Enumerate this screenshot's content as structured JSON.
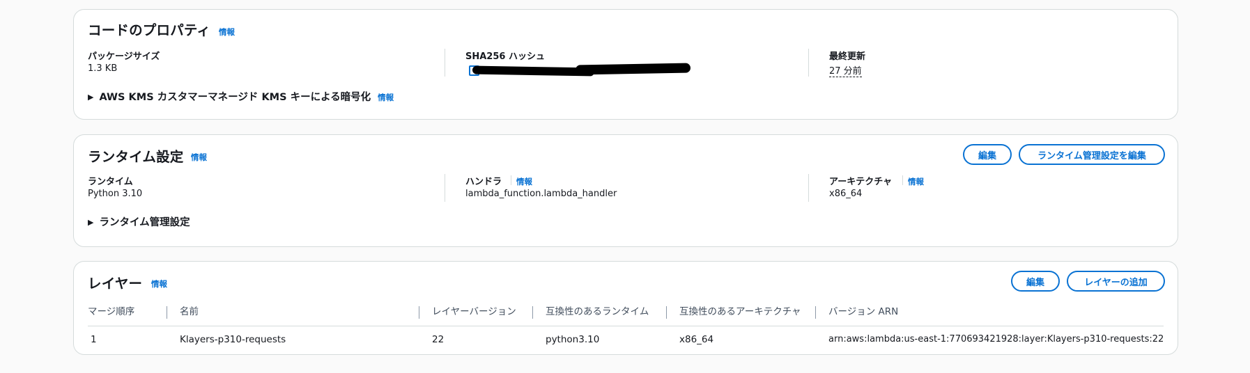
{
  "code_props": {
    "title": "コードのプロパティ",
    "info": "情報",
    "package_size_label": "パッケージサイズ",
    "package_size_value": "1.3 KB",
    "sha_label": "SHA256 ハッシュ",
    "last_modified_label": "最終更新",
    "last_modified_value": "27 分前",
    "kms_label": "AWS KMS カスタマーマネージド KMS キーによる暗号化",
    "kms_info": "情報"
  },
  "runtime": {
    "title": "ランタイム設定",
    "info": "情報",
    "edit_button": "編集",
    "edit_mgmt_button": "ランタイム管理設定を編集",
    "runtime_label": "ランタイム",
    "runtime_value": "Python 3.10",
    "handler_label": "ハンドラ",
    "handler_info": "情報",
    "handler_value": "lambda_function.lambda_handler",
    "arch_label": "アーキテクチャ",
    "arch_info": "情報",
    "arch_value": "x86_64",
    "mgmt_label": "ランタイム管理設定"
  },
  "layers": {
    "title": "レイヤー",
    "info": "情報",
    "edit_button": "編集",
    "add_button": "レイヤーの追加",
    "columns": [
      "マージ順序",
      "名前",
      "レイヤーバージョン",
      "互換性のあるランタイム",
      "互換性のあるアーキテクチャ",
      "バージョン ARN"
    ],
    "rows": [
      [
        "1",
        "Klayers-p310-requests",
        "22",
        "python3.10",
        "x86_64",
        "arn:aws:lambda:us-east-1:770693421928:layer:Klayers-p310-requests:22"
      ]
    ]
  },
  "icons": {
    "copy": "copy-icon",
    "expand": "caret-right-icon"
  },
  "colors": {
    "link": "#0972d3",
    "border": "#d5dbdb",
    "text": "#16191f"
  }
}
